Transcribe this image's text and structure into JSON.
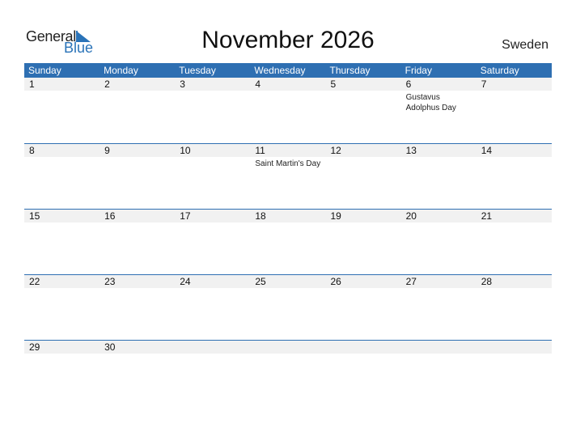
{
  "logo": {
    "word1": "General",
    "word2": "Blue"
  },
  "title": "November 2026",
  "country": "Sweden",
  "colors": {
    "accent": "#2e6fb2",
    "row_shade": "#f1f1f1"
  },
  "weekdays": [
    "Sunday",
    "Monday",
    "Tuesday",
    "Wednesday",
    "Thursday",
    "Friday",
    "Saturday"
  ],
  "weeks": [
    {
      "days": [
        "1",
        "2",
        "3",
        "4",
        "5",
        "6",
        "7"
      ],
      "events": [
        "",
        "",
        "",
        "",
        "",
        "Gustavus Adolphus Day",
        ""
      ]
    },
    {
      "days": [
        "8",
        "9",
        "10",
        "11",
        "12",
        "13",
        "14"
      ],
      "events": [
        "",
        "",
        "",
        "Saint Martin's Day",
        "",
        "",
        ""
      ]
    },
    {
      "days": [
        "15",
        "16",
        "17",
        "18",
        "19",
        "20",
        "21"
      ],
      "events": [
        "",
        "",
        "",
        "",
        "",
        "",
        ""
      ]
    },
    {
      "days": [
        "22",
        "23",
        "24",
        "25",
        "26",
        "27",
        "28"
      ],
      "events": [
        "",
        "",
        "",
        "",
        "",
        "",
        ""
      ]
    },
    {
      "days": [
        "29",
        "30",
        "",
        "",
        "",
        "",
        ""
      ],
      "events": [
        "",
        "",
        "",
        "",
        "",
        "",
        ""
      ]
    }
  ]
}
